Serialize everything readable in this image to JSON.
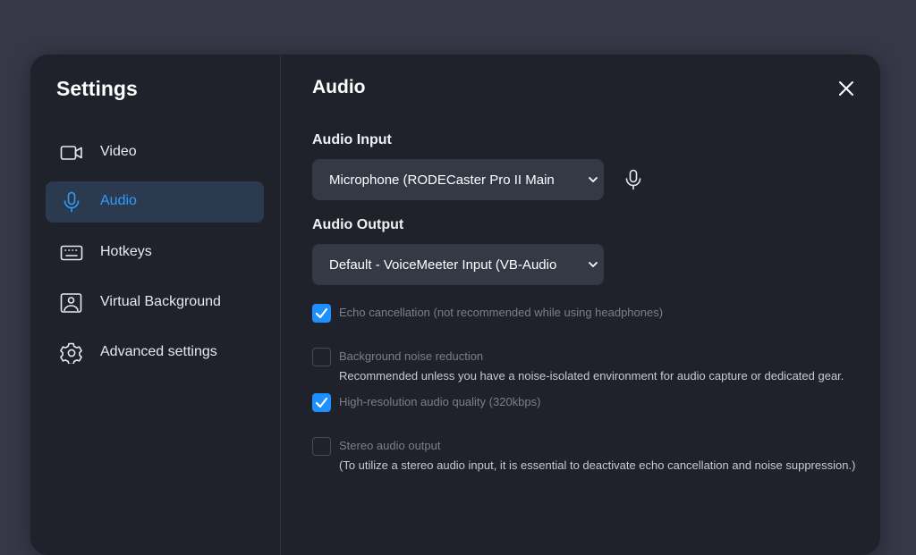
{
  "sidebar": {
    "title": "Settings",
    "items": [
      {
        "label": "Video",
        "icon": "video-camera-icon"
      },
      {
        "label": "Audio",
        "icon": "microphone-icon",
        "active": true
      },
      {
        "label": "Hotkeys",
        "icon": "keyboard-icon"
      },
      {
        "label": "Virtual Background",
        "icon": "image-icon"
      },
      {
        "label": "Advanced settings",
        "icon": "gear-icon"
      }
    ]
  },
  "main": {
    "title": "Audio",
    "close_icon": "close-icon",
    "audio_input": {
      "label": "Audio Input",
      "selected": "Microphone (RODECaster Pro II Main",
      "test_icon": "microphone-icon"
    },
    "audio_output": {
      "label": "Audio Output",
      "selected": "Default - VoiceMeeter Input (VB-Audio"
    },
    "options": [
      {
        "label": "Echo cancellation (not recommended while using headphones)",
        "checked": true,
        "description": ""
      },
      {
        "label": "Background noise reduction",
        "checked": false,
        "description": "Recommended unless you have a noise-isolated environment for audio capture or dedicated gear."
      },
      {
        "label": "High-resolution audio quality (320kbps)",
        "checked": true,
        "description": ""
      },
      {
        "label": "Stereo audio output",
        "checked": false,
        "description": "(To utilize a stereo audio input, it is essential to deactivate echo cancellation and noise suppression.)"
      }
    ]
  },
  "colors": {
    "accent": "#1e8fff",
    "active_nav_bg": "#2c3a4f",
    "dialog_bg": "#1f222b",
    "backdrop": "#363848"
  }
}
